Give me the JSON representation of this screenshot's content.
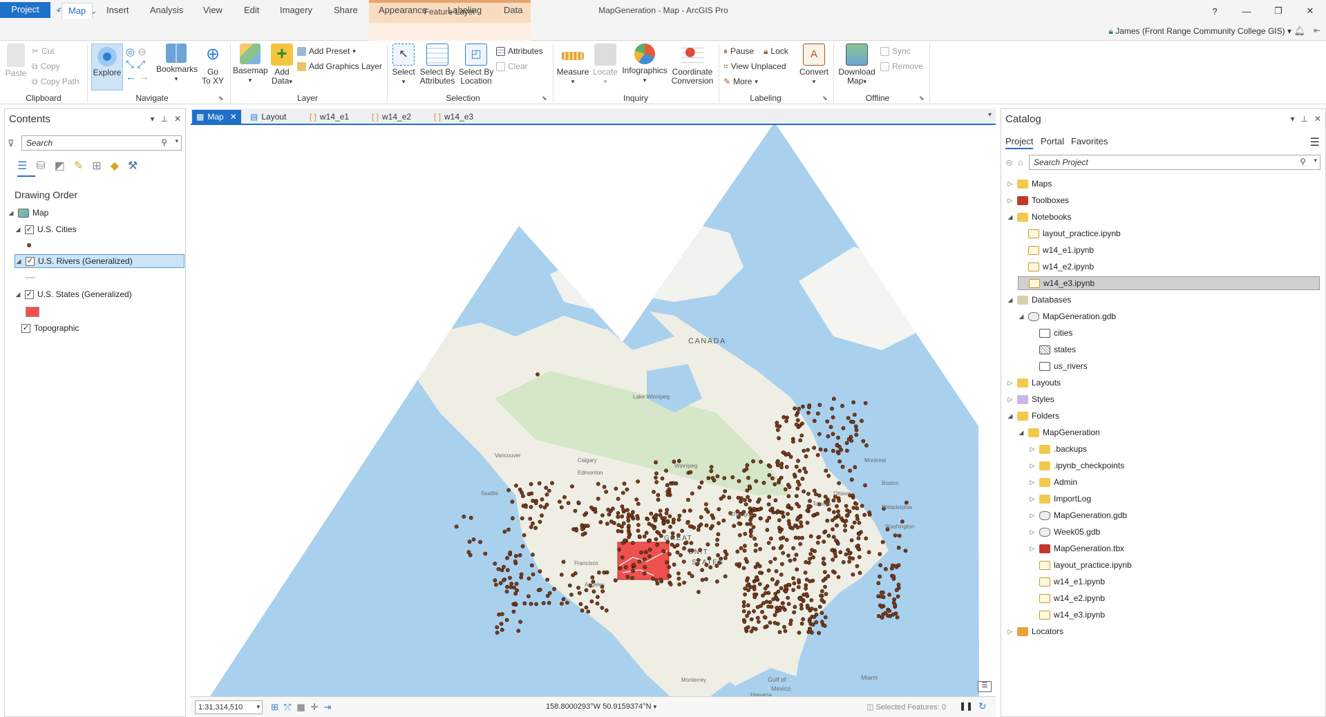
{
  "window": {
    "title": "MapGeneration - Map - ArcGIS Pro",
    "context_tab_title": "Feature Layer",
    "user": "James (Front Range Community College GIS)"
  },
  "ribbon_tabs": [
    "Project",
    "Map",
    "Insert",
    "Analysis",
    "View",
    "Edit",
    "Imagery",
    "Share",
    "Appearance",
    "Labeling",
    "Data"
  ],
  "ribbon": {
    "clipboard": {
      "label": "Clipboard",
      "paste": "Paste",
      "cut": "Cut",
      "copy": "Copy",
      "copy_path": "Copy Path"
    },
    "navigate": {
      "label": "Navigate",
      "explore": "Explore",
      "bookmarks": "Bookmarks",
      "go_to_xy_1": "Go",
      "go_to_xy_2": "To XY"
    },
    "layer": {
      "label": "Layer",
      "basemap": "Basemap",
      "add_data_1": "Add",
      "add_data_2": "Data",
      "add_preset": "Add Preset",
      "add_graphics_layer": "Add Graphics Layer"
    },
    "selection": {
      "label": "Selection",
      "select": "Select",
      "select_by_attr_1": "Select By",
      "select_by_attr_2": "Attributes",
      "select_by_loc_1": "Select By",
      "select_by_loc_2": "Location",
      "attributes": "Attributes",
      "clear": "Clear"
    },
    "inquiry": {
      "label": "Inquiry",
      "measure": "Measure",
      "locate": "Locate",
      "infographics": "Infographics",
      "coord_conv_1": "Coordinate",
      "coord_conv_2": "Conversion"
    },
    "labeling": {
      "label": "Labeling",
      "pause": "Pause",
      "lock": "Lock",
      "view_unplaced": "View Unplaced",
      "more": "More",
      "convert": "Convert"
    },
    "offline": {
      "label": "Offline",
      "download_map_1": "Download",
      "download_map_2": "Map",
      "sync": "Sync",
      "remove": "Remove"
    }
  },
  "contents": {
    "title": "Contents",
    "search_placeholder": "Search",
    "heading": "Drawing Order",
    "map_label": "Map",
    "layers": [
      {
        "name": "U.S. Cities",
        "checked": true,
        "symbol_color": "#7a3b1e"
      },
      {
        "name": "U.S. Rivers (Generalized)",
        "checked": true,
        "selected": true,
        "symbol_color": "#bcd4f0"
      },
      {
        "name": "U.S. States (Generalized)",
        "checked": true,
        "symbol_color": "#f0504f"
      },
      {
        "name": "Topographic",
        "checked": true
      }
    ]
  },
  "map_tabs": [
    {
      "label": "Map",
      "active": true
    },
    {
      "label": "Layout"
    },
    {
      "label": "w14_e1"
    },
    {
      "label": "w14_e2"
    },
    {
      "label": "w14_e3"
    }
  ],
  "map": {
    "labels": [
      "CANADA",
      "GREAT",
      "UNIT",
      "STATES",
      "Gulf of",
      "Mexico",
      "Havana",
      "Miami",
      "Boston",
      "Montreal",
      "Philadelphia",
      "Washington",
      "Calgary",
      "Edmonton",
      "Francisco",
      "Angeles",
      "Monterrey",
      "Lake Winnipeg",
      "Ottawa",
      "Toronto",
      "Chicago",
      "Winnipeg",
      "Vancouver",
      "Seattle"
    ],
    "colors": {
      "ocean": "#a9d1ee",
      "land": "#efeee4",
      "forest": "#cfe3c1",
      "states_fill": "#f0504f",
      "city_point": "#7a3b1e"
    }
  },
  "status": {
    "scale": "1:31,314,510",
    "coordinates": "158.8000293°W 50.9159374°N",
    "selected_features": "Selected Features: 0"
  },
  "catalog": {
    "title": "Catalog",
    "tabs": [
      "Project",
      "Portal",
      "Favorites"
    ],
    "search_placeholder": "Search Project",
    "tree": [
      {
        "label": "Maps",
        "indent": 0,
        "expanded": false,
        "icon": "folder-icon"
      },
      {
        "label": "Toolboxes",
        "indent": 0,
        "expanded": false,
        "icon": "toolbox-icon"
      },
      {
        "label": "Notebooks",
        "indent": 0,
        "expanded": true,
        "icon": "folder-icon"
      },
      {
        "label": "layout_practice.ipynb",
        "indent": 1,
        "icon": "notebook-icon"
      },
      {
        "label": "w14_e1.ipynb",
        "indent": 1,
        "icon": "notebook-icon"
      },
      {
        "label": "w14_e2.ipynb",
        "indent": 1,
        "icon": "notebook-icon"
      },
      {
        "label": "w14_e3.ipynb",
        "indent": 1,
        "icon": "notebook-icon",
        "selected": true
      },
      {
        "label": "Databases",
        "indent": 0,
        "expanded": true,
        "icon": "database-folder-icon"
      },
      {
        "label": "MapGeneration.gdb",
        "indent": 1,
        "expanded": true,
        "icon": "geodatabase-icon"
      },
      {
        "label": "cities",
        "indent": 2,
        "icon": "point-fc-icon"
      },
      {
        "label": "states",
        "indent": 2,
        "icon": "polygon-fc-icon"
      },
      {
        "label": "us_rivers",
        "indent": 2,
        "icon": "line-fc-icon"
      },
      {
        "label": "Layouts",
        "indent": 0,
        "expanded": false,
        "icon": "folder-icon"
      },
      {
        "label": "Styles",
        "indent": 0,
        "expanded": false,
        "icon": "style-icon"
      },
      {
        "label": "Folders",
        "indent": 0,
        "expanded": true,
        "icon": "folder-icon"
      },
      {
        "label": "MapGeneration",
        "indent": 1,
        "expanded": true,
        "icon": "folder-icon"
      },
      {
        "label": ".backups",
        "indent": 2,
        "expanded": false,
        "icon": "folder-icon"
      },
      {
        "label": ".ipynb_checkpoints",
        "indent": 2,
        "expanded": false,
        "icon": "folder-icon"
      },
      {
        "label": "Admin",
        "indent": 2,
        "expanded": false,
        "icon": "folder-icon"
      },
      {
        "label": "ImportLog",
        "indent": 2,
        "expanded": false,
        "icon": "folder-icon"
      },
      {
        "label": "MapGeneration.gdb",
        "indent": 2,
        "expanded": false,
        "icon": "geodatabase-icon"
      },
      {
        "label": "Week05.gdb",
        "indent": 2,
        "expanded": false,
        "icon": "geodatabase-icon"
      },
      {
        "label": "MapGeneration.tbx",
        "indent": 2,
        "expanded": false,
        "icon": "toolbox-icon"
      },
      {
        "label": "layout_practice.ipynb",
        "indent": 2,
        "icon": "notebook-icon"
      },
      {
        "label": "w14_e1.ipynb",
        "indent": 2,
        "icon": "notebook-icon"
      },
      {
        "label": "w14_e2.ipynb",
        "indent": 2,
        "icon": "notebook-icon"
      },
      {
        "label": "w14_e3.ipynb",
        "indent": 2,
        "icon": "notebook-icon"
      },
      {
        "label": "Locators",
        "indent": 0,
        "expanded": false,
        "icon": "locator-icon"
      }
    ]
  }
}
